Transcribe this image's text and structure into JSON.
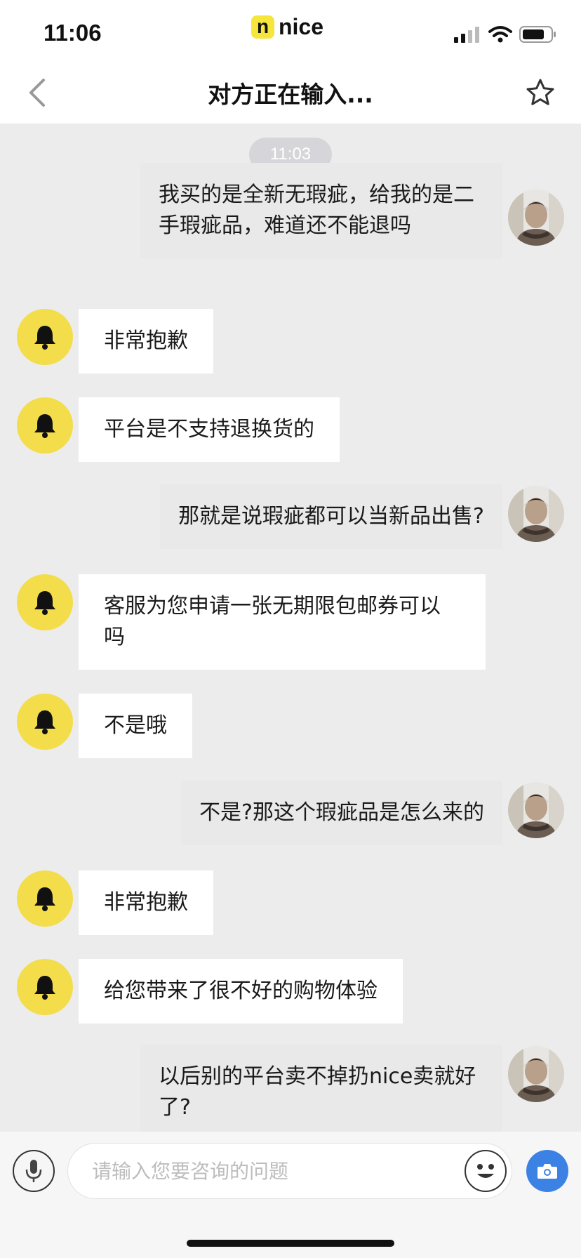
{
  "status_bar": {
    "time": "11:06",
    "brand_badge": "n",
    "brand_name": "nice"
  },
  "nav": {
    "title": "对方正在输入..."
  },
  "chat": {
    "timestamp": "11:03",
    "messages": [
      {
        "from": "user",
        "text": "我买的是全新无瑕疵，给我的是二手瑕疵品，难道还不能退吗"
      },
      {
        "from": "service",
        "text": "非常抱歉"
      },
      {
        "from": "service",
        "text": "平台是不支持退换货的"
      },
      {
        "from": "user",
        "text": "那就是说瑕疵都可以当新品出售?"
      },
      {
        "from": "service",
        "text": "客服为您申请一张无期限包邮券可以吗"
      },
      {
        "from": "service",
        "text": "不是哦"
      },
      {
        "from": "user",
        "text": "不是?那这个瑕疵品是怎么来的"
      },
      {
        "from": "service",
        "text": "非常抱歉"
      },
      {
        "from": "service",
        "text": "给您带来了很不好的购物体验"
      },
      {
        "from": "user",
        "text": "以后别的平台卖不掉扔nice卖就好了?"
      }
    ]
  },
  "input": {
    "placeholder": "请输入您要咨询的问题",
    "value": ""
  },
  "icons": {
    "back": "chevron-left-icon",
    "favorite": "star-icon",
    "service_avatar": "bell-icon",
    "voice": "microphone-icon",
    "emoji": "smiley-icon",
    "camera": "camera-icon"
  },
  "colors": {
    "brand_yellow": "#f6e53a",
    "chat_background": "#ececec",
    "camera_blue": "#3b82e4"
  }
}
